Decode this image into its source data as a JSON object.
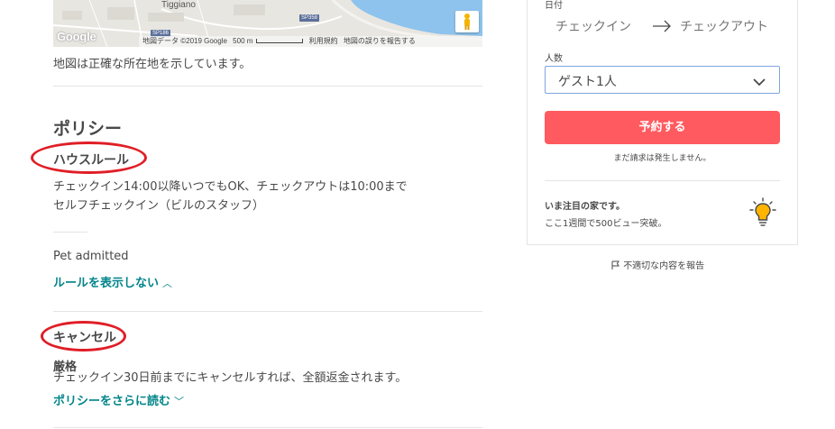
{
  "map": {
    "town_label": "Tiggiano",
    "road_1": "SP186",
    "road_2": "SP358",
    "google_logo": "Google",
    "attribution": "地図データ ©2019 Google",
    "scale": "500 m",
    "terms": "利用規約",
    "report_error": "地図の誤りを報告する",
    "caption": "地図は正確な所在地を示しています。"
  },
  "policies": {
    "heading": "ポリシー",
    "house_rules": {
      "heading": "ハウスルール",
      "lines": [
        "チェックイン14:00以降いつでもOK、チェックアウトは10:00まで",
        "セルフチェックイン（ビルのスタッフ）"
      ],
      "pet": "Pet admitted",
      "toggle_link": "ルールを表示しない"
    },
    "cancellation": {
      "heading": "キャンセル",
      "type": "厳格",
      "description": "チェックイン30日前までにキャンセルすれば、全額返金されます。",
      "more_link": "ポリシーをさらに読む"
    }
  },
  "booking": {
    "dates_label": "日付",
    "checkin_placeholder": "チェックイン",
    "checkout_placeholder": "チェックアウト",
    "guests_label": "人数",
    "guests_value": "ゲスト1人",
    "reserve_button": "予約する",
    "no_charge_note": "まだ請求は発生しません。",
    "rare_find_title": "いま注目の家です。",
    "rare_find_desc": "ここ1週間で500ビュー突破。"
  },
  "report_listing": "不適切な内容を報告",
  "colors": {
    "accent_red": "#ff5a5f",
    "link_teal": "#008489",
    "annotation_red": "#e01e26",
    "text": "#484848"
  }
}
